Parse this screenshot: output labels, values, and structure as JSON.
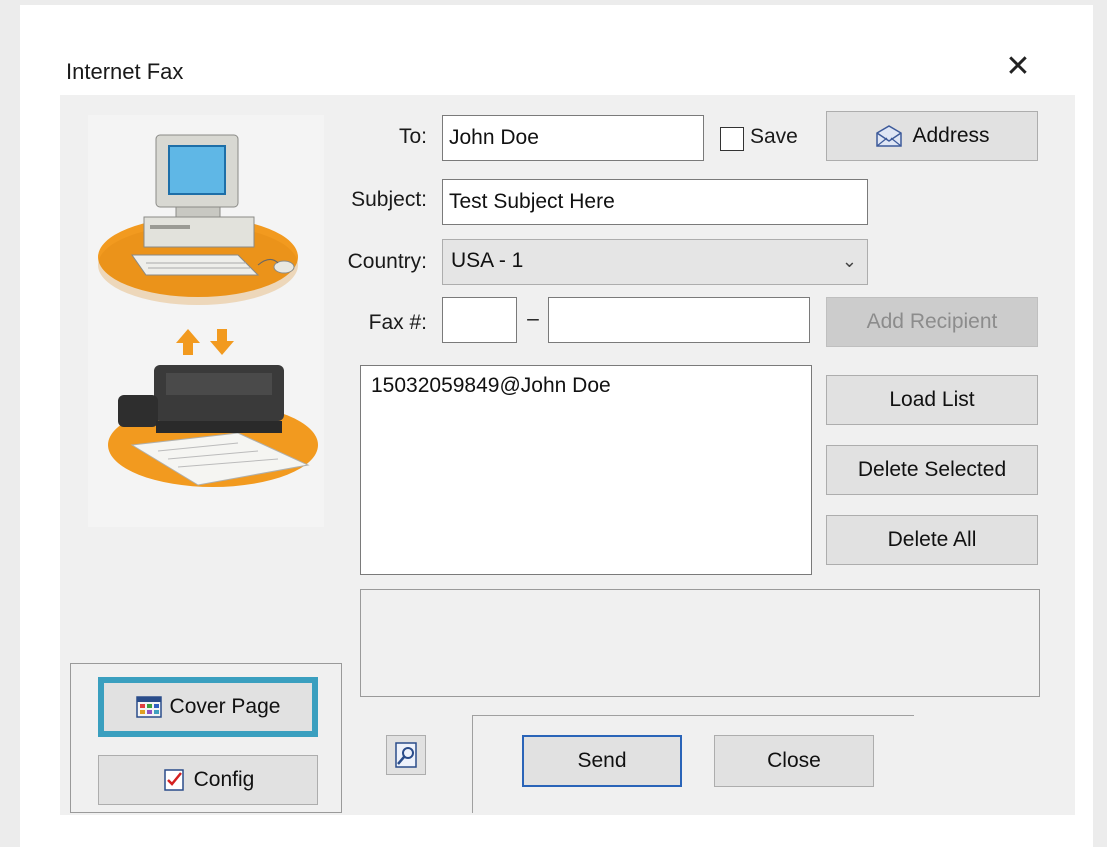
{
  "window": {
    "title": "Internet Fax"
  },
  "fields": {
    "to_label": "To:",
    "to_value": "John Doe",
    "save_label": "Save",
    "subject_label": "Subject:",
    "subject_value": "Test Subject Here",
    "country_label": "Country:",
    "country_value": "USA - 1",
    "fax_label": "Fax #:",
    "fax_separator": "–",
    "fax_area": "",
    "fax_number": ""
  },
  "buttons": {
    "address": "Address",
    "add_recipient": "Add Recipient",
    "load_list": "Load List",
    "delete_selected": "Delete Selected",
    "delete_all": "Delete All",
    "cover_page": "Cover Page",
    "config": "Config",
    "send": "Send",
    "close": "Close"
  },
  "recipients": [
    "15032059849@John Doe"
  ],
  "icons": {
    "close": "close-icon",
    "address": "envelope-icon",
    "cover_page": "grid-icon",
    "config": "checklist-icon",
    "preview": "magnifier-icon"
  },
  "colors": {
    "focus_ring": "#3a9fbf",
    "send_border": "#2a64b8",
    "orange": "#f29a1f"
  }
}
